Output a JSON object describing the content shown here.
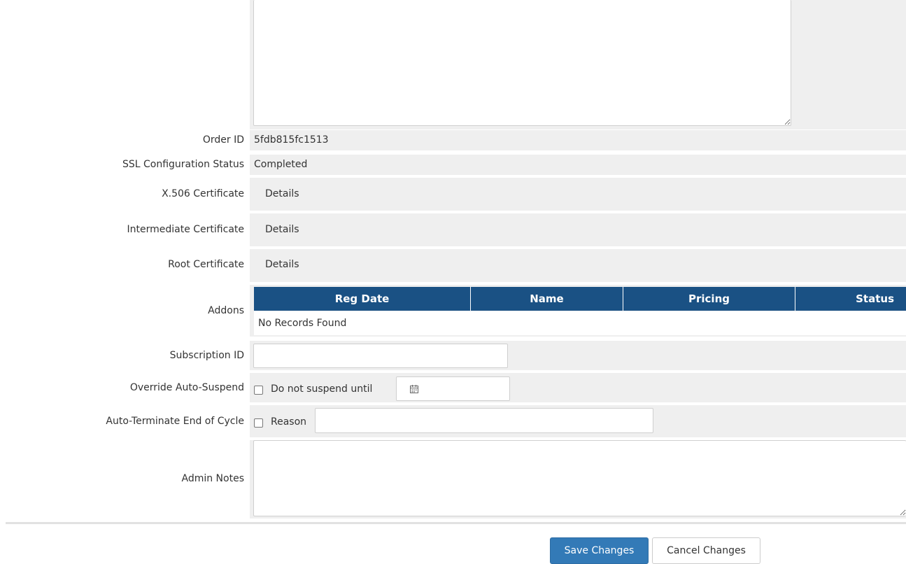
{
  "fields": {
    "order_id": {
      "label": "Order ID",
      "value": "5fdb815fc1513"
    },
    "ssl_status": {
      "label": "SSL Configuration Status",
      "value": "Completed"
    },
    "x506": {
      "label": "X.506 Certificate",
      "link": "Details"
    },
    "intermediate": {
      "label": "Intermediate Certificate",
      "link": "Details"
    },
    "root": {
      "label": "Root Certificate",
      "link": "Details"
    },
    "addons": {
      "label": "Addons",
      "columns": [
        "Reg Date",
        "Name",
        "Pricing",
        "Status"
      ],
      "empty_text": "No Records Found"
    },
    "subscription_id": {
      "label": "Subscription ID",
      "value": "",
      "placeholder": ""
    },
    "override_auto_suspend": {
      "label": "Override Auto-Suspend",
      "checkbox_label": "Do not suspend until",
      "checked": false,
      "date_value": ""
    },
    "auto_terminate": {
      "label": "Auto-Terminate End of Cycle",
      "checkbox_label": "Reason",
      "checked": false,
      "reason_value": ""
    },
    "admin_notes": {
      "label": "Admin Notes",
      "value": ""
    }
  },
  "buttons": {
    "save": "Save Changes",
    "cancel": "Cancel Changes"
  },
  "colors": {
    "table_header": "#1a5184",
    "save_button": "#337ab7",
    "field_background": "#efefef"
  },
  "icons": {
    "date_picker": "calendar-icon"
  }
}
